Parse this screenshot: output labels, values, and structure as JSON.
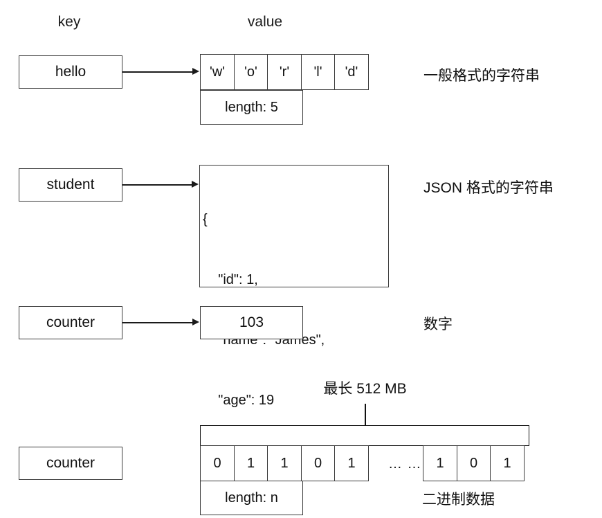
{
  "headers": {
    "key": "key",
    "value": "value"
  },
  "rows": [
    {
      "key": "hello",
      "chars": [
        "'w'",
        "'o'",
        "'r'",
        "'l'",
        "'d'"
      ],
      "length_label": "length: 5",
      "note": "一般格式的字符串"
    },
    {
      "key": "student",
      "json_lines": [
        "{",
        "    \"id\": 1,",
        "    \"name\": \"James\",",
        "    \"age\": 19",
        "}"
      ],
      "note": "JSON 格式的字符串"
    },
    {
      "key": "counter",
      "value": "103",
      "note": "数字"
    },
    {
      "key": "counter",
      "max_size_label": "最长 512 MB",
      "bits_left": [
        "0",
        "1",
        "1",
        "0",
        "1"
      ],
      "ellipsis": "… …",
      "bits_right": [
        "1",
        "0",
        "1"
      ],
      "length_label": "length: n",
      "note": "二进制数据"
    }
  ],
  "colors": {
    "stroke": "#3a3a3a",
    "text": "#111111",
    "background": "#ffffff"
  }
}
